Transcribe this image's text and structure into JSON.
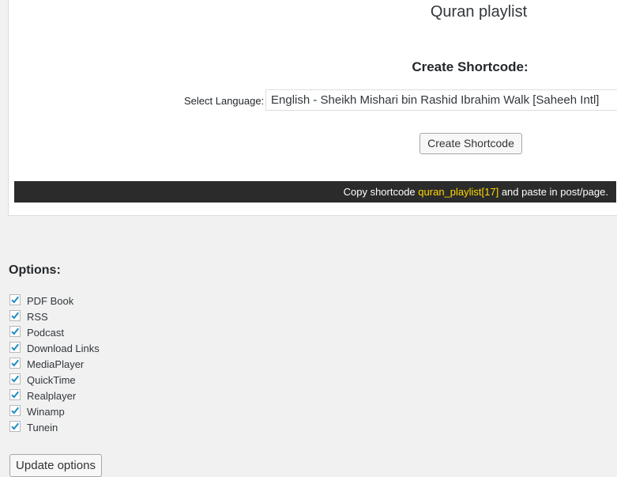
{
  "panel": {
    "title": "Quran playlist",
    "heading": "Create Shortcode:",
    "language_label": "Select Language:",
    "language_value": "English - Sheikh Mishari bin Rashid Ibrahim Walk [Saheeh Intl]",
    "create_button": "Create Shortcode",
    "shortcode_bar": {
      "prefix": "Copy shortcode",
      "code": "quran_playlist[17]",
      "suffix": "and paste in post/page.",
      "highlight_color": "#ffd800"
    }
  },
  "options": {
    "title": "Options:",
    "items": [
      {
        "label": "PDF Book",
        "checked": true
      },
      {
        "label": "RSS",
        "checked": true
      },
      {
        "label": "Podcast",
        "checked": true
      },
      {
        "label": "Download Links",
        "checked": true
      },
      {
        "label": "MediaPlayer",
        "checked": true
      },
      {
        "label": "QuickTime",
        "checked": true
      },
      {
        "label": "Realplayer",
        "checked": true
      },
      {
        "label": "Winamp",
        "checked": true
      },
      {
        "label": "Tunein",
        "checked": true
      }
    ],
    "checkmark_color": "#1e8cbe",
    "update_button": "Update options"
  }
}
